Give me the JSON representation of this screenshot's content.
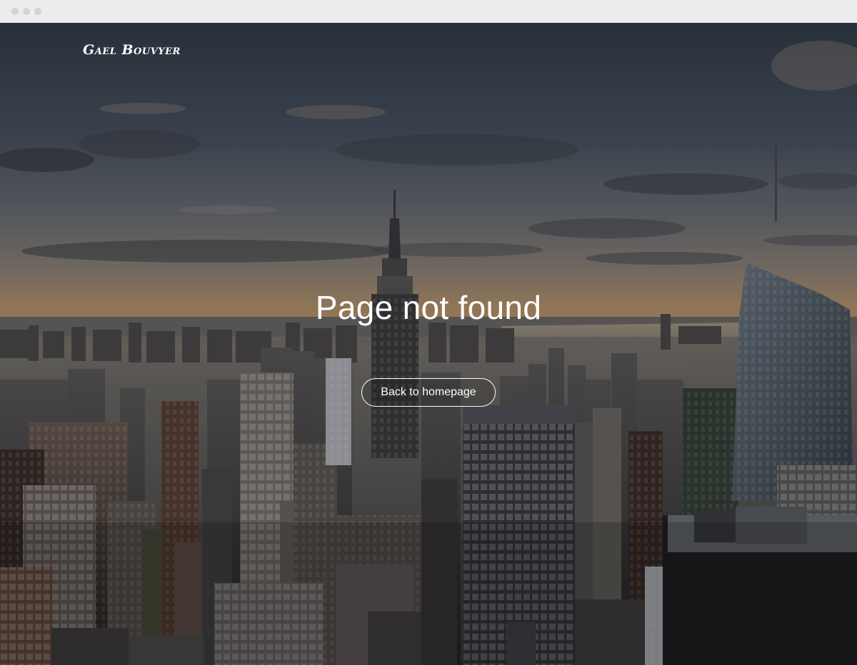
{
  "site": {
    "brand": "Gael Bouvyer"
  },
  "error_page": {
    "headline": "Page not found",
    "back_button_label": "Back to homepage"
  },
  "colors": {
    "text": "#ffffff",
    "sky_top": "#3a4553",
    "horizon": "#c9985f",
    "city_dark": "#1f2026"
  },
  "background": {
    "subject": "city-skyline-photo"
  }
}
